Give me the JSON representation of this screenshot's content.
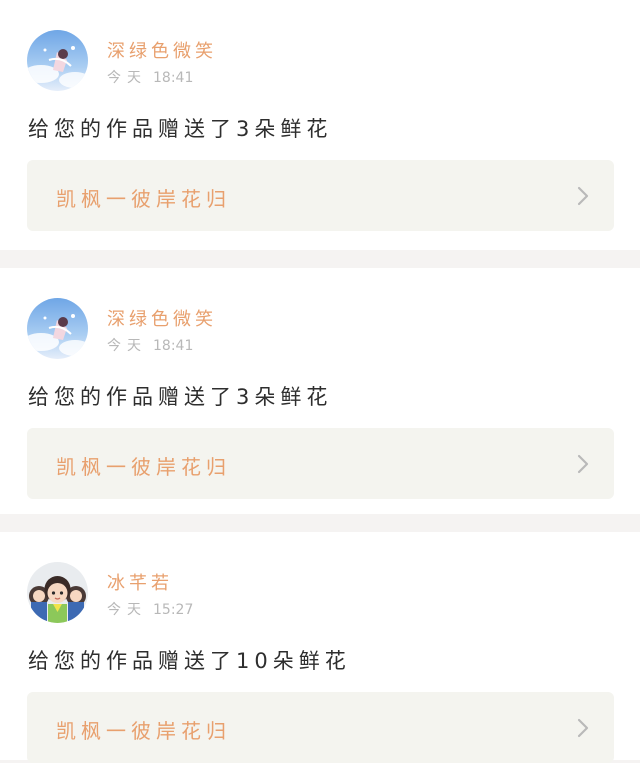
{
  "notifications": [
    {
      "user": "深绿色微笑",
      "day": "今天",
      "time": "18:41",
      "message": "给您的作品赠送了3朵鲜花",
      "work_title": "凯枫一彼岸花归",
      "avatar": "anime-girl-sky-avatar"
    },
    {
      "user": "深绿色微笑",
      "day": "今天",
      "time": "18:41",
      "message": "给您的作品赠送了3朵鲜花",
      "work_title": "凯枫一彼岸花归",
      "avatar": "anime-girl-sky-avatar"
    },
    {
      "user": "冰芊若",
      "day": "今天",
      "time": "15:27",
      "message": "给您的作品赠送了10朵鲜花",
      "work_title": "凯枫一彼岸花归",
      "avatar": "cartoon-boys-group-avatar"
    }
  ],
  "colors": {
    "accent": "#e8a06e",
    "card_background": "#ffffff",
    "page_background": "#f5f3f2",
    "link_background": "#f4f4ef",
    "meta_text": "#b8b8b8",
    "body_text": "#2e2e2e"
  },
  "icons": {
    "chevron": "chevron-right-icon"
  }
}
